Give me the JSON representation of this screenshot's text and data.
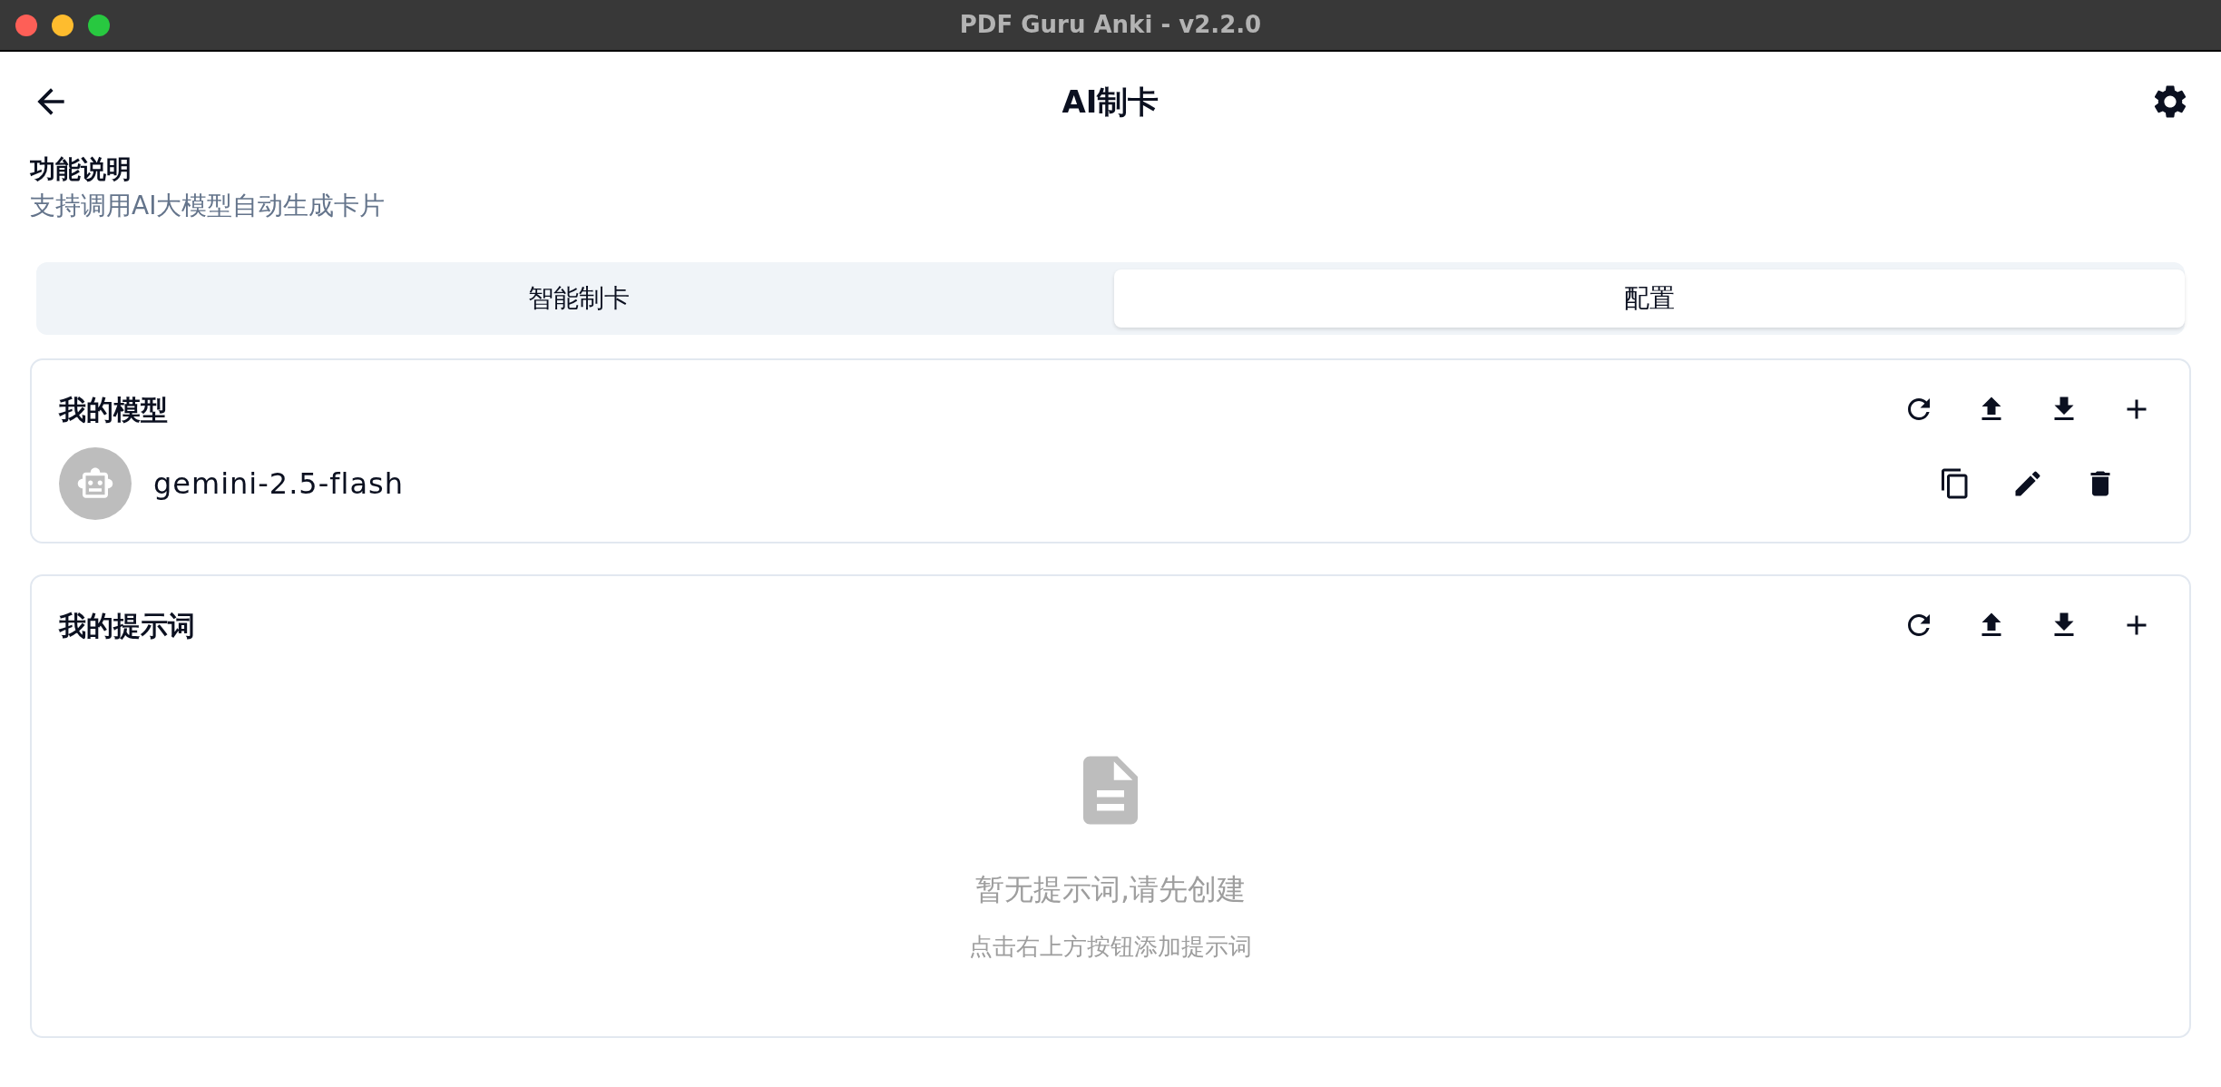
{
  "window": {
    "title": "PDF Guru Anki - v2.2.0"
  },
  "header": {
    "title": "AI制卡"
  },
  "description": {
    "label": "功能说明",
    "text": "支持调用AI大模型自动生成卡片"
  },
  "tabs": [
    {
      "label": "智能制卡",
      "selected": false
    },
    {
      "label": "配置",
      "selected": true
    }
  ],
  "models": {
    "title": "我的模型",
    "items": [
      {
        "name": "gemini-2.5-flash"
      }
    ]
  },
  "prompts": {
    "title": "我的提示词",
    "empty": {
      "title": "暂无提示词,请先创建",
      "hint": "点击右上方按钮添加提示词"
    }
  }
}
